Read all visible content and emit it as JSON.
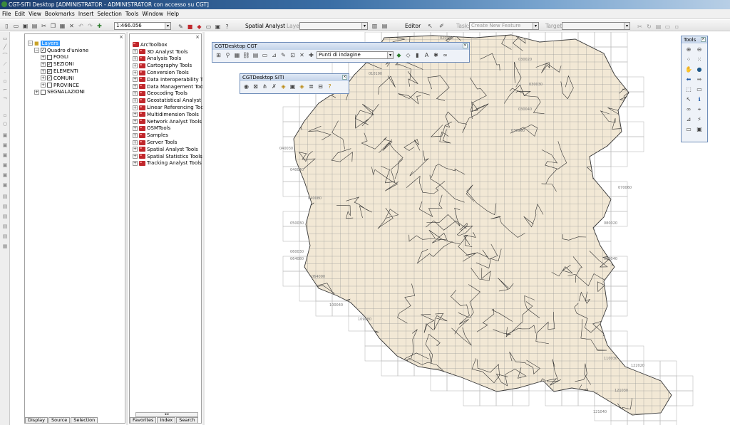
{
  "window": {
    "title": "CGT-SITI Desktop  [ADMINISTRATOR - ADMINISTRATOR con accesso su CGT]"
  },
  "menu": [
    "File",
    "Edit",
    "View",
    "Bookmarks",
    "Insert",
    "Selection",
    "Tools",
    "Window",
    "Help"
  ],
  "toolbar": {
    "scale": "1:466.056",
    "spatial_analyst": "Spatial Analyst",
    "layer_label": "Layer:",
    "editor": "Editor",
    "task_label": "Task:",
    "task_value": "Create New Feature",
    "target_label": "Target:"
  },
  "toc": {
    "root": "Layers",
    "group": "Quadro d'unione",
    "layers": [
      {
        "name": "FOGLI",
        "checked": false
      },
      {
        "name": "SEZIONI",
        "checked": true
      },
      {
        "name": "ELEMENTI",
        "checked": true
      },
      {
        "name": "COMUNI",
        "checked": true
      },
      {
        "name": "PROVINCE",
        "checked": false
      }
    ],
    "extra": "SEGNALAZIONI",
    "tabs": [
      "Display",
      "Source",
      "Selection"
    ]
  },
  "toolbox": {
    "root": "ArcToolbox",
    "items": [
      "3D Analyst Tools",
      "Analysis Tools",
      "Cartography Tools",
      "Conversion Tools",
      "Data Interoperability Tools",
      "Data Management Tools",
      "Geocoding Tools",
      "Geostatistical Analyst Tools",
      "Linear Referencing Tools",
      "Multidimension Tools",
      "Network Analyst Tools",
      "OSMTools",
      "Samples",
      "Server Tools",
      "Spatial Analyst Tools",
      "Spatial Statistics Tools",
      "Tracking Analyst Tools"
    ],
    "tabs": [
      "Favorites",
      "Index",
      "Search"
    ]
  },
  "cgt_toolbar": {
    "title": "CGTDesktop CGT",
    "dropdown": "Punti di indagine"
  },
  "siti_toolbar": {
    "title": "CGTDesktop SITI"
  },
  "tools_toolbar": {
    "title": "Tools"
  },
  "colors": {
    "map_fill": "#f2e8d5",
    "grid": "#9a9a9a",
    "boundary": "#333333",
    "tile": "#bdbdbd"
  },
  "map": {
    "labels": [
      "010180",
      "010190",
      "020190",
      "030020",
      "030030",
      "030040",
      "030050",
      "040030",
      "040040",
      "040080",
      "050030",
      "060030",
      "064080",
      "064090",
      "070060",
      "080020",
      "090040",
      "100040",
      "109080",
      "110030",
      "121030",
      "121040",
      "122020"
    ]
  }
}
